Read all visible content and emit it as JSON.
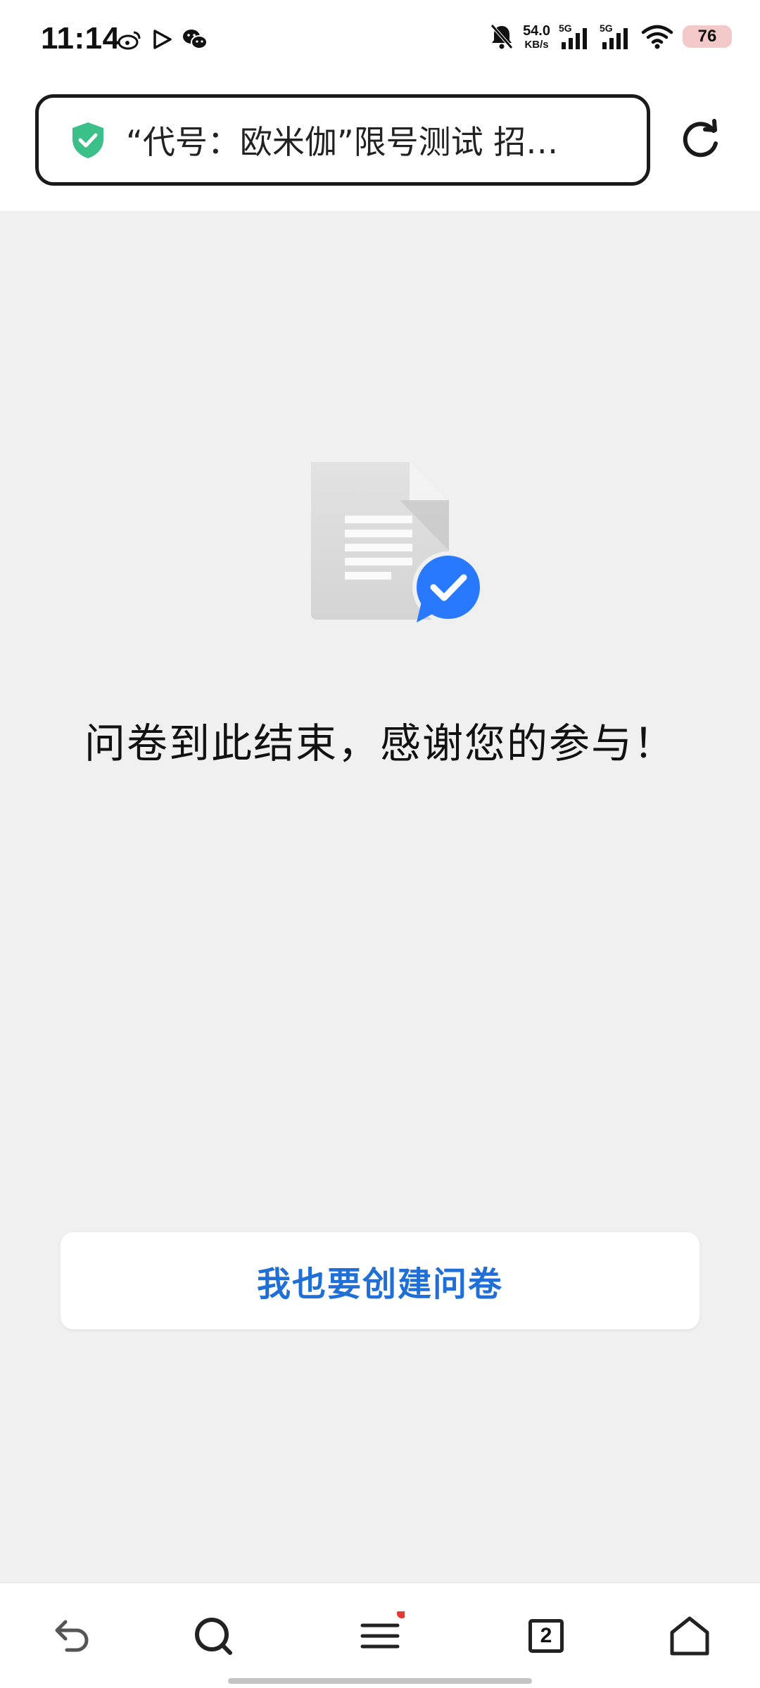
{
  "status_bar": {
    "time": "11:14",
    "net_speed_value": "54.0",
    "net_speed_unit": "KB/s",
    "sim1": "5G",
    "sim2": "5G",
    "battery": "76"
  },
  "address_bar": {
    "title": "“代号：欧米伽”限号测试 招…"
  },
  "main": {
    "end_message": "问卷到此结束，感谢您的参与！",
    "create_button_label": "我也要创建问卷"
  },
  "bottom_nav": {
    "tab_count": "2"
  },
  "colors": {
    "accent_blue": "#1f6fd6",
    "badge_blue": "#2979ff",
    "shield_green": "#3cc08a",
    "notification_dot": "#e53935"
  },
  "icons": {
    "status_left": [
      "weibo-icon",
      "play-icon",
      "wechat-icon"
    ],
    "status_right": [
      "mute-bell-icon",
      "signal-icon",
      "signal-icon",
      "wifi-icon",
      "battery-icon"
    ],
    "address": [
      "shield-check-icon",
      "reload-icon"
    ],
    "nav": [
      "back-icon",
      "search-icon",
      "menu-icon",
      "tabs-icon",
      "home-icon"
    ]
  }
}
